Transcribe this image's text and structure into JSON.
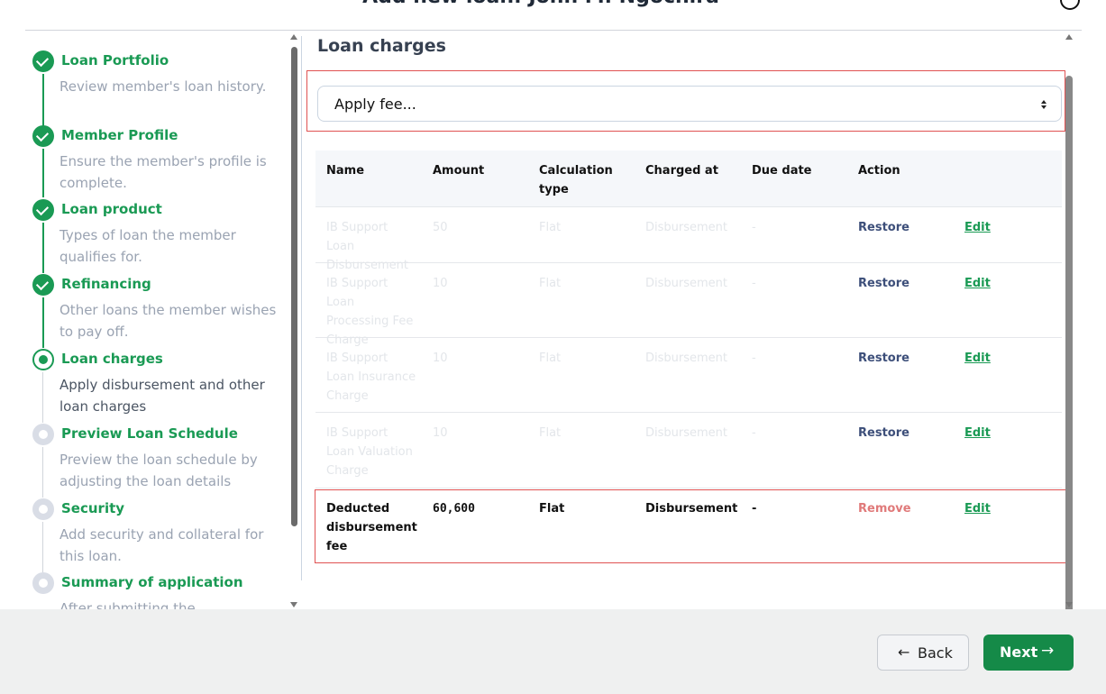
{
  "header": {
    "title": "Add new loan: John M. Ngochira"
  },
  "stepper": {
    "steps": [
      {
        "title": "Loan Portfolio",
        "desc": "Review member's loan history."
      },
      {
        "title": "Member Profile",
        "desc": "Ensure the member's profile is complete."
      },
      {
        "title": "Loan product",
        "desc": "Types of loan the member qualifies for."
      },
      {
        "title": "Refinancing",
        "desc": "Other loans the member wishes to pay off."
      },
      {
        "title": "Loan charges",
        "desc": "Apply disbursement and other loan charges"
      },
      {
        "title": "Preview Loan Schedule",
        "desc": "Preview the loan schedule by adjusting the loan details"
      },
      {
        "title": "Security",
        "desc": "Add security and collateral for this loan."
      },
      {
        "title": "Summary of application",
        "desc": "After submitting the"
      }
    ]
  },
  "main": {
    "section_title": "Loan charges",
    "select": {
      "value": "Apply fee..."
    },
    "table": {
      "headers": {
        "name": "Name",
        "amount": "Amount",
        "calc": "Calculation type",
        "charged": "Charged at",
        "due": "Due date",
        "action": "Action"
      },
      "rows": [
        {
          "name": "IB Support Loan Disbursement",
          "amount": "50",
          "calc": "Flat",
          "charged": "Disbursement",
          "due": "-",
          "action": "Restore",
          "edit": "Edit"
        },
        {
          "name": "IB Support Loan Processing Fee Charge",
          "amount": "10",
          "calc": "Flat",
          "charged": "Disbursement",
          "due": "-",
          "action": "Restore",
          "edit": "Edit"
        },
        {
          "name": "IB Support Loan Insurance Charge",
          "amount": "10",
          "calc": "Flat",
          "charged": "Disbursement",
          "due": "-",
          "action": "Restore",
          "edit": "Edit"
        },
        {
          "name": "IB Support Loan Valuation Charge",
          "amount": "10",
          "calc": "Flat",
          "charged": "Disbursement",
          "due": "-",
          "action": "Restore",
          "edit": "Edit"
        },
        {
          "name": "Deducted disbursement fee",
          "amount": "60,600",
          "calc": "Flat",
          "charged": "Disbursement",
          "due": "-",
          "action": "Remove",
          "edit": "Edit"
        }
      ]
    }
  },
  "footer": {
    "back_label": "Back",
    "next_label": "Next"
  }
}
